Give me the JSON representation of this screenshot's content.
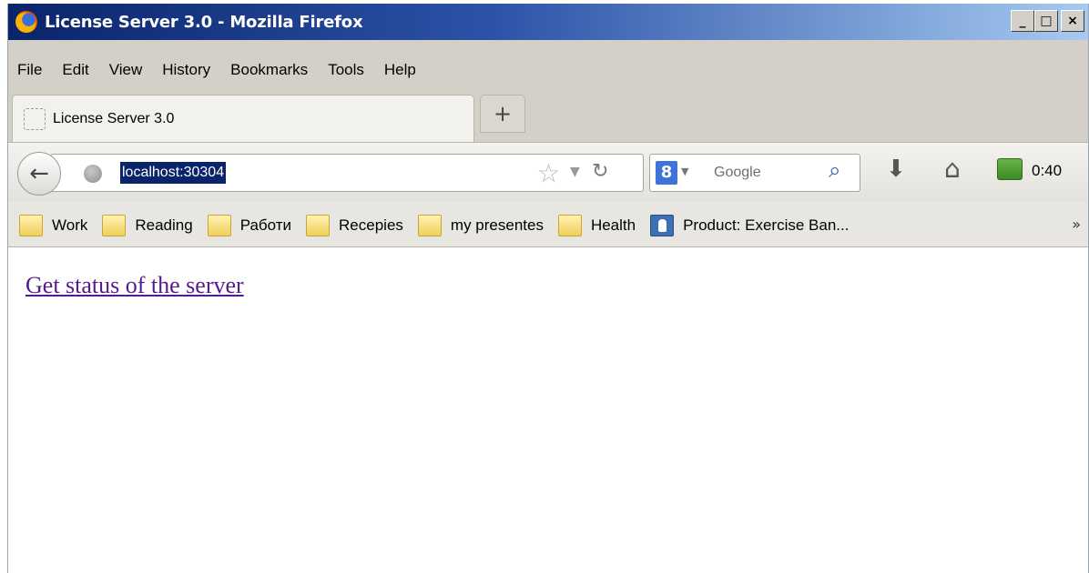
{
  "window": {
    "title": "License Server 3.0 - Mozilla Firefox",
    "buttons": {
      "minimize": "_",
      "maximize": "□",
      "close": "×"
    }
  },
  "menu": [
    "File",
    "Edit",
    "View",
    "History",
    "Bookmarks",
    "Tools",
    "Help"
  ],
  "tabs": [
    {
      "label": "License Server 3.0",
      "active": true
    }
  ],
  "newtab_label": "+",
  "navbar": {
    "url": "localhost:30304",
    "search_placeholder": "Google",
    "timer": "0:40"
  },
  "icons": {
    "back": "back-arrow-icon",
    "globe": "globe-icon",
    "star": "bookmark-star-icon",
    "reload": "reload-icon",
    "search_engine": "google-icon",
    "magnifier": "magnifier-icon",
    "downloads": "download-arrow-icon",
    "home": "home-icon",
    "addon": "addon-icon"
  },
  "bookmarks": [
    {
      "label": "Work",
      "icon": "folder"
    },
    {
      "label": "Reading",
      "icon": "folder"
    },
    {
      "label": "Работи",
      "icon": "folder"
    },
    {
      "label": "Recepies",
      "icon": "folder"
    },
    {
      "label": "my presentes",
      "icon": "folder"
    },
    {
      "label": "Health",
      "icon": "folder"
    },
    {
      "label": "Product: Exercise Ban...",
      "icon": "product"
    }
  ],
  "bookmarks_overflow": "»",
  "content": {
    "link_text": "Get status of the server"
  },
  "colors": {
    "titlebar_start": "#0a246a",
    "titlebar_end": "#a6caf0",
    "visited_link": "#551a8b",
    "url_selection": "#0a246a"
  }
}
